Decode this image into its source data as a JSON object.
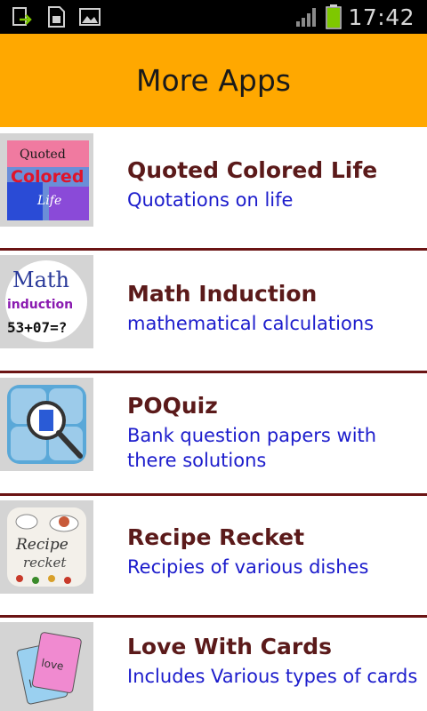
{
  "status_bar": {
    "time": "17:42",
    "icons": [
      "upload-icon",
      "sim-card-icon",
      "image-icon",
      "signal-icon",
      "battery-icon"
    ],
    "colors": {
      "background": "#000000",
      "battery": "#7ec800"
    }
  },
  "header": {
    "title": "More Apps",
    "color": "#FFA800"
  },
  "apps": [
    {
      "title": "Quoted Colored Life",
      "description": "Quotations on life",
      "icon": "quoted-colored-life-icon"
    },
    {
      "title": "Math Induction",
      "description": "mathematical calculations",
      "icon": "math-induction-icon"
    },
    {
      "title": "POQuiz",
      "description": "Bank question papers with there solutions",
      "icon": "poquiz-icon"
    },
    {
      "title": "Recipe Recket",
      "description": "Recipies of various dishes",
      "icon": "recipe-recket-icon"
    },
    {
      "title": "Love With Cards",
      "description": "Includes Various types of cards",
      "icon": "love-with-cards-icon"
    }
  ],
  "icon_text": {
    "quoted": [
      "Quoted",
      "Colored",
      "Life"
    ],
    "math": [
      "Math",
      "induction",
      "53+07=?"
    ],
    "recipe": [
      "Recipe",
      "recket"
    ],
    "love": [
      "love",
      "love"
    ]
  },
  "colors": {
    "title": "#5b1a1a",
    "description": "#1c1ccc",
    "divider": "#6b1414"
  }
}
